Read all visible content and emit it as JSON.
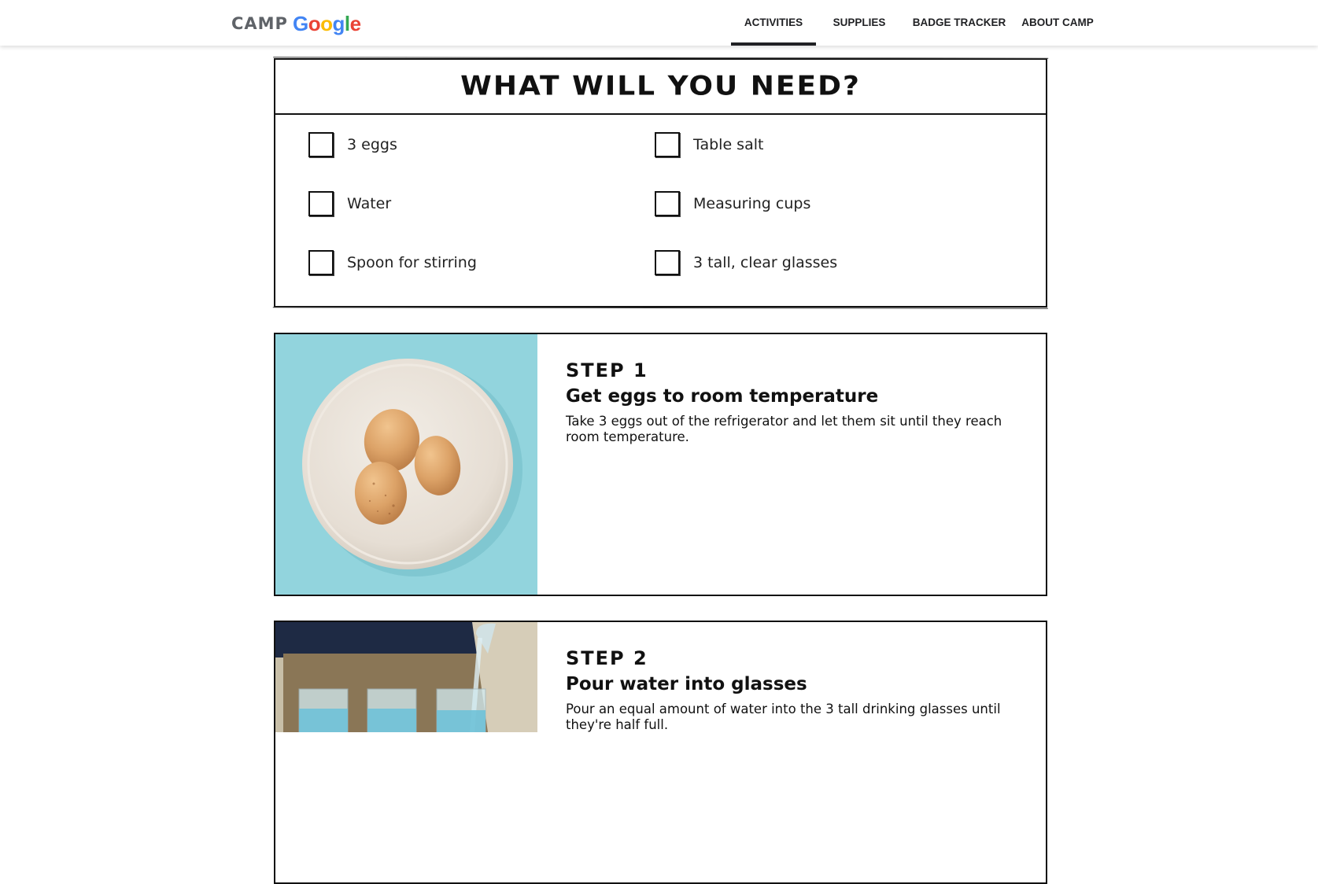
{
  "header": {
    "logo_word": "CAMP",
    "logo_brand": [
      "G",
      "o",
      "o",
      "g",
      "l",
      "e"
    ],
    "brand_colors": [
      "#4285F4",
      "#EA4335",
      "#FBBC05",
      "#4285F4",
      "#34A853",
      "#EA4335"
    ],
    "nav": [
      {
        "label": "ACTIVITIES",
        "active": true
      },
      {
        "label": "SUPPLIES",
        "active": false
      },
      {
        "label": "BADGE TRACKER",
        "active": false
      },
      {
        "label": "ABOUT CAMP",
        "active": false
      }
    ]
  },
  "needs": {
    "title": "What will you need?",
    "items": [
      {
        "label": "3 eggs",
        "checked": false
      },
      {
        "label": "Table salt",
        "checked": false
      },
      {
        "label": "Water",
        "checked": false
      },
      {
        "label": "Measuring cups",
        "checked": false
      },
      {
        "label": "Spoon for stirring",
        "checked": false
      },
      {
        "label": "3 tall, clear glasses",
        "checked": false
      }
    ]
  },
  "steps": [
    {
      "number": "Step 1",
      "title": "Get eggs to room temperature",
      "description": "Take 3 eggs out of the refrigerator and let them sit until they reach room temperature.",
      "photo_bg": "#8fd3dc"
    },
    {
      "number": "Step 2",
      "title": "Pour water into glasses",
      "description": "Pour an equal amount of water into the 3 tall drinking glasses until they're half full.",
      "photo_bg": "#6b5a45"
    }
  ]
}
